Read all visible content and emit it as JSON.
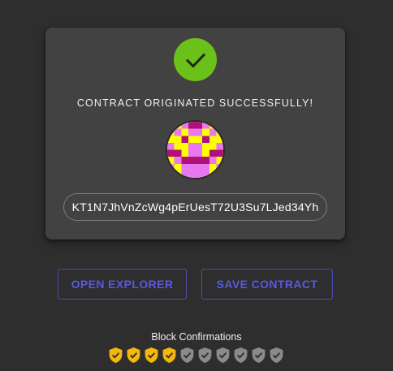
{
  "card": {
    "status_icon": "check-circle-icon",
    "title": "CONTRACT ORIGINATED SUCCESSFULLY!",
    "address": "KT1N7JhVnZcWg4pErUesT72U3Su7LJed34Yh"
  },
  "buttons": {
    "open_explorer": "OPEN EXPLORER",
    "save_contract": "SAVE CONTRACT"
  },
  "confirmations": {
    "label": "Block Confirmations",
    "confirmed": 4,
    "total": 10,
    "icon": "shield-check-icon"
  },
  "colors": {
    "success": "#6bc11a",
    "accent": "#5a58e0",
    "confirmed": "#f5b80a",
    "pending": "#8a8a8a"
  }
}
